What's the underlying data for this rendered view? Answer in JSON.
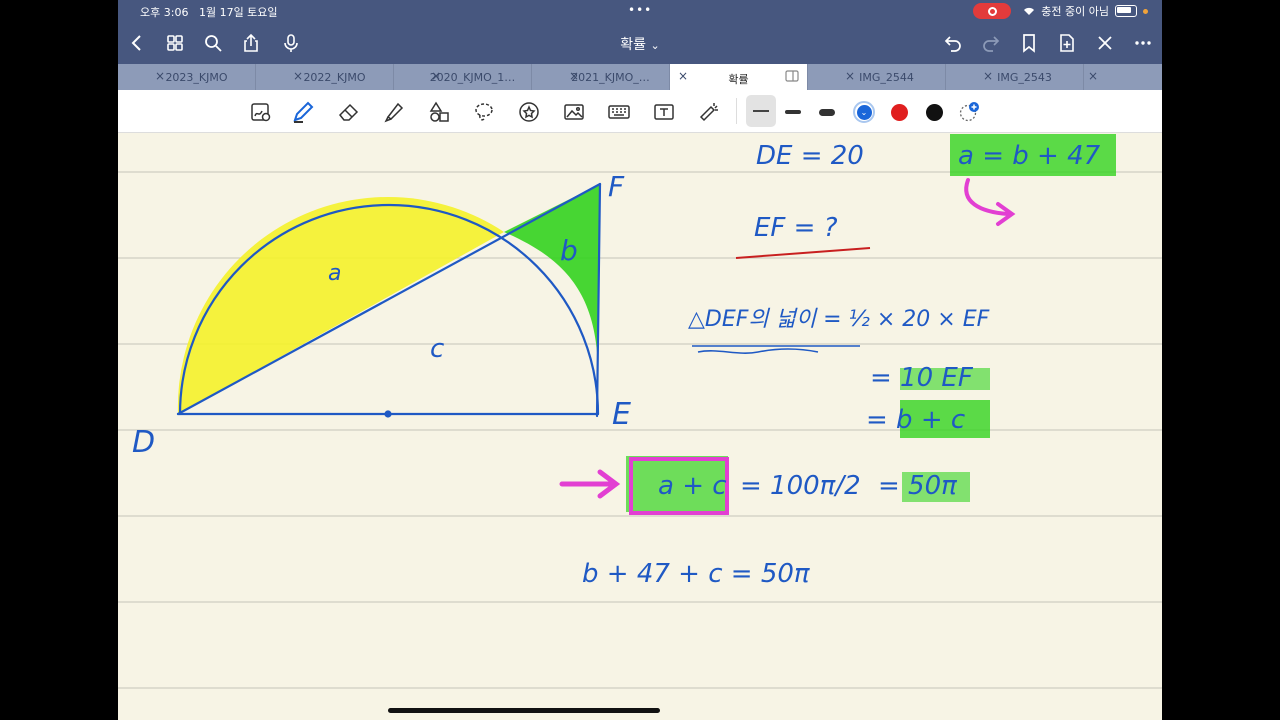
{
  "status": {
    "time": "오후 3:06",
    "date": "1월 17일 토요일",
    "charging": "충전 중이 아님"
  },
  "nav": {
    "title": "확률",
    "chevron": "⌄",
    "icons": [
      "back-icon",
      "grid-icon",
      "search-icon",
      "share-icon",
      "mic-icon",
      "undo-icon",
      "redo-icon",
      "bookmark-icon",
      "add-page-icon",
      "close-icon",
      "more-icon"
    ]
  },
  "tabs": [
    {
      "label": "2023_KJMO",
      "close": "×"
    },
    {
      "label": "2022_KJMO",
      "close": "×"
    },
    {
      "label": "2020_KJMO_1…",
      "close": "×"
    },
    {
      "label": "2021_KJMO_…",
      "close": "×"
    },
    {
      "label": "확률",
      "close": "×",
      "active": true
    },
    {
      "label": "IMG_2544",
      "close": "×"
    },
    {
      "label": "IMG_2543",
      "close": "×"
    }
  ],
  "tools": [
    "ai-lasso-icon",
    "pen-icon",
    "eraser-icon",
    "highlighter-icon",
    "shapes-icon",
    "lasso-icon",
    "sticker-icon",
    "image-icon",
    "keyboard-icon",
    "text-icon",
    "laser-pointer-icon"
  ],
  "pen_colors": {
    "blue": "#1a66d9",
    "red": "#e01f1f",
    "black": "#111111"
  },
  "note": {
    "colors": {
      "ink": "#1f59c4",
      "yellow": "#f4f22a",
      "green": "#33d31f",
      "magenta": "#e23fd2",
      "red": "#c81f1f",
      "paper": "#f7f4e5",
      "rule": "#cfcdc2"
    },
    "labels": {
      "D": "D",
      "E": "E",
      "F": "F",
      "a": "a",
      "b": "b",
      "c": "c"
    },
    "lines": {
      "de": "DE = 20",
      "aeq": "a = b + 47",
      "ef": "EF = ?",
      "area": "△DEF의 넓이 = ½ × 20 × EF",
      "eq10": "= 10 EF",
      "eqbc": "= b + c",
      "ac": "a + c",
      "ac_rhs": "= 100π/2",
      "ac_result": "= 50π",
      "final": "b + 47 + c = 50π"
    }
  }
}
